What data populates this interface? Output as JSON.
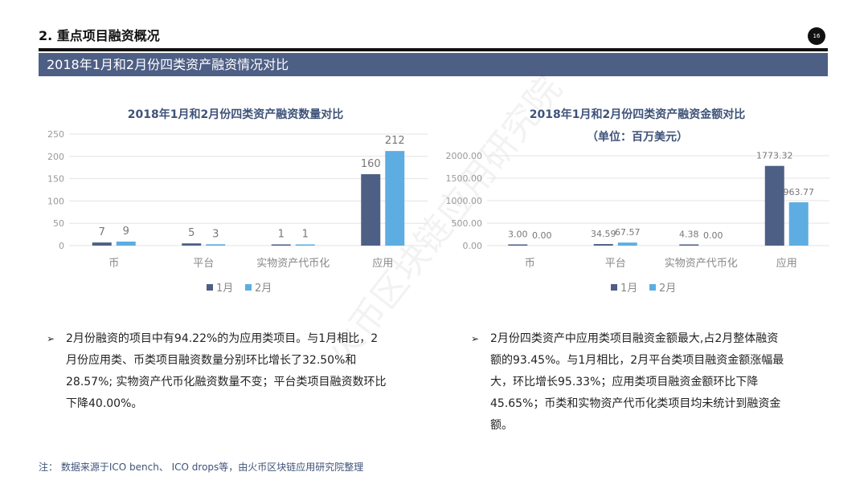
{
  "header": {
    "section_title": "2. 重点项目融资概况",
    "page_number": "16",
    "banner_title": "2018年1月和2月份四类资产融资情况对比"
  },
  "watermark": "火币区块链应用研究院",
  "left_chart": {
    "title": "2018年1月和2月份四类资产融资数量对比"
  },
  "right_chart": {
    "title": "2018年1月和2月份四类资产融资金额对比",
    "subtitle": "（单位：百万美元）"
  },
  "chart_data": [
    {
      "type": "bar",
      "title": "2018年1月和2月份四类资产融资数量对比",
      "categories": [
        "币",
        "平台",
        "实物资产代币化",
        "应用"
      ],
      "series": [
        {
          "name": "1月",
          "values": [
            7,
            5,
            1,
            160
          ],
          "labels": [
            "7",
            "5",
            "1",
            "160"
          ],
          "color": "#4e5f85"
        },
        {
          "name": "2月",
          "values": [
            9,
            3,
            1,
            212
          ],
          "labels": [
            "9",
            "3",
            "1",
            "212"
          ],
          "color": "#5dade2"
        }
      ],
      "yticks": [
        "0",
        "50",
        "100",
        "150",
        "200",
        "250"
      ],
      "ylim": [
        0,
        250
      ],
      "legend_position": "bottom",
      "grid": true
    },
    {
      "type": "bar",
      "title": "2018年1月和2月份四类资产融资金额对比",
      "subtitle": "（单位：百万美元）",
      "categories": [
        "币",
        "平台",
        "实物资产代币化",
        "应用"
      ],
      "series": [
        {
          "name": "1月",
          "values": [
            3.0,
            34.59,
            4.38,
            1773.32
          ],
          "labels": [
            "3.00",
            "34.59",
            "4.38",
            "1773.32"
          ],
          "color": "#4e5f85"
        },
        {
          "name": "2月",
          "values": [
            0.0,
            67.57,
            0.0,
            963.77
          ],
          "labels": [
            "0.00",
            "67.57",
            "0.00",
            "963.77"
          ],
          "color": "#5dade2"
        }
      ],
      "yticks": [
        "0.00",
        "500.00",
        "1000.00",
        "1500.00",
        "2000.00"
      ],
      "ylim": [
        0,
        2000
      ],
      "legend_position": "bottom",
      "grid": true
    }
  ],
  "bullets": [
    {
      "arrow": "➢",
      "lines": [
        "2月份融资的项目中有94.22%的为应用类项目。与1月相比，2",
        "月份应用类、币类项目融资数量分别环比增长了32.50%和",
        "28.57%; 实物资产代币化融资数量不变；平台类项目融资数环比",
        "下降40.00%。"
      ]
    },
    {
      "arrow": "➢",
      "lines": [
        "2月份四类资产中应用类项目融资金额最大,占2月整体融资",
        "额的93.45%。与1月相比，2月平台类项目融资金额涨幅最",
        "大，环比增长95.33%；应用类项目融资金额环比下降",
        "45.65%；币类和实物资产代币化类项目均未统计到融资金",
        "额。"
      ]
    }
  ],
  "footnote": "注：  数据来源于ICO bench、 ICO drops等，由火币区块链应用研究院整理"
}
